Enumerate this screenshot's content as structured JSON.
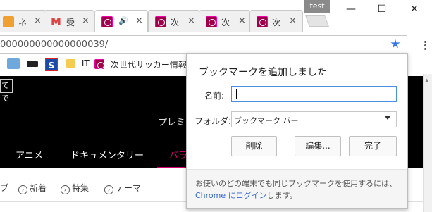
{
  "browser": {
    "profile_name": "test",
    "tabs": [
      {
        "title": "ネ",
        "favicon": "orange-site-icon",
        "close": "×"
      },
      {
        "title": "受",
        "favicon": "gmail-icon",
        "close": "×"
      },
      {
        "title": "",
        "favicon": "site-logo-icon",
        "audio": "🔊",
        "close": "×",
        "active": true
      },
      {
        "title": "次",
        "favicon": "site-logo-icon",
        "close": "×"
      },
      {
        "title": "次",
        "favicon": "site-logo-icon",
        "close": "×"
      },
      {
        "title": "次",
        "favicon": "site-logo-icon",
        "close": "×"
      }
    ],
    "window_controls": {
      "minimize": "—",
      "maximize": "☐",
      "close": "✕"
    },
    "url": "000000000000000039/",
    "bookmarks_bar": [
      {
        "label": "",
        "icon": "enterprise-icon"
      },
      {
        "label": "",
        "icon": "bbc-icon"
      },
      {
        "label": "",
        "icon": "s-icon"
      },
      {
        "label": "IT",
        "icon": "folder-icon"
      },
      {
        "label": "次世代サッカー情報番",
        "icon": "site-logo-icon"
      }
    ]
  },
  "page": {
    "search_tag": "てで",
    "premium_text": "プレミ",
    "nav_items": [
      "アニメ",
      "ドキュメンタリー",
      "バラ"
    ],
    "subnav_items": [
      "ブ",
      "新着",
      "特集",
      "テーマ"
    ],
    "accent_color": "#d4006b"
  },
  "bookmark_bubble": {
    "title": "ブックマークを追加しました",
    "name_label": "名前:",
    "name_value": "",
    "folder_label": "フォルダ:",
    "folder_value": "ブックマーク バー",
    "remove_button": "削除",
    "edit_button": "編集...",
    "done_button": "完了",
    "footer_text": "お使いのどの端末でも同じブックマークを使用するには、",
    "footer_link": "Chrome にログイン",
    "footer_suffix": "します。"
  }
}
